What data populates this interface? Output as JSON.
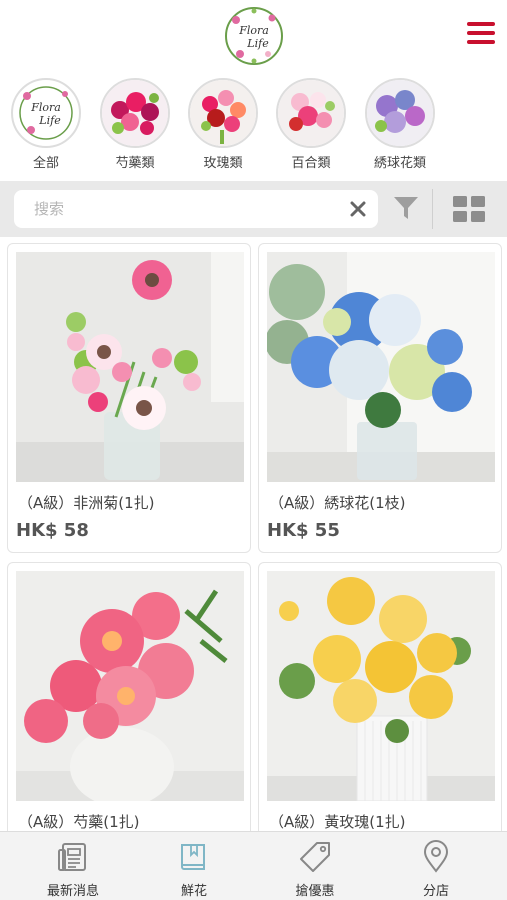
{
  "header": {
    "logo_text_line1": "Flora",
    "logo_text_line2": "Life",
    "brand_color": "#c8102e"
  },
  "categories": [
    {
      "label": "全部",
      "icon": "flora-life-logo"
    },
    {
      "label": "芍藥類",
      "icon": "peony-flowers"
    },
    {
      "label": "玫瑰類",
      "icon": "rose-flowers"
    },
    {
      "label": "百合類",
      "icon": "lily-flowers"
    },
    {
      "label": "綉球花類",
      "icon": "hydrangea-flowers"
    }
  ],
  "search": {
    "placeholder": "搜索",
    "value": ""
  },
  "products": [
    {
      "name": "（A級）非洲菊(1扎)",
      "price": "HK$ 58",
      "image": "gerbera-bouquet"
    },
    {
      "name": "（A級）綉球花(1枝)",
      "price": "HK$ 55",
      "image": "hydrangea-bouquet"
    },
    {
      "name": "（A級）芍藥(1扎)",
      "price": "",
      "image": "peony-bouquet"
    },
    {
      "name": "（A級）黃玫瑰(1扎)",
      "price": "",
      "image": "yellow-rose-bouquet"
    }
  ],
  "bottom_nav": [
    {
      "label": "最新消息",
      "icon": "news-icon"
    },
    {
      "label": "鮮花",
      "icon": "book-icon",
      "active": true
    },
    {
      "label": "搶優惠",
      "icon": "tag-icon"
    },
    {
      "label": "分店",
      "icon": "location-pin-icon"
    }
  ],
  "colors": {
    "accent": "#c8102e",
    "active_nav": "#7fb6c6",
    "nav_icon": "#888888"
  }
}
